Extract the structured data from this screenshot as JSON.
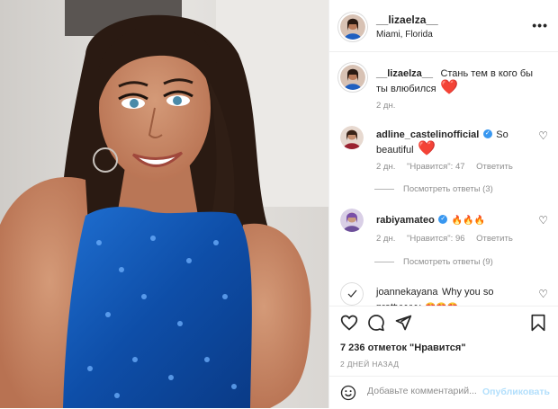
{
  "post": {
    "author": "__lizaelza__",
    "location": "Miami, Florida",
    "more_label": "•••",
    "caption": {
      "user": "__lizaelza__",
      "text": "Стань тем в кого бы ты влюбился",
      "emoji": "❤️",
      "time": "2 дн."
    }
  },
  "comments": [
    {
      "user": "adline_castelinofficial",
      "verified": true,
      "text": "So beautiful",
      "emoji": "❤️",
      "time": "2 дн.",
      "likes": "\"Нравится\": 47",
      "reply": "Ответить",
      "view_replies": "Посмотреть ответы (3)"
    },
    {
      "user": "rabiyamateo",
      "verified": true,
      "text": "",
      "emoji": "🔥🔥🔥",
      "time": "2 дн.",
      "likes": "\"Нравится\": 96",
      "reply": "Ответить",
      "view_replies": "Посмотреть ответы (9)"
    },
    {
      "user": "joannekayana",
      "verified": false,
      "text": "Why you so prettyyyyy",
      "emoji": "😍😍😍"
    }
  ],
  "actions": {
    "likes": "7 236 отметок \"Нравится\"",
    "date": "2 ДНЕЙ НАЗАД",
    "comment_placeholder": "Добавьте комментарий...",
    "post_button": "Опубликовать"
  },
  "icons": [
    "heart-icon",
    "comment-icon",
    "share-icon",
    "bookmark-icon",
    "emoji-icon",
    "verified-icon",
    "more-icon"
  ],
  "colors": {
    "accent_blue": "#0095f6",
    "post_disabled": "#b2dffc",
    "heart_red": "#ed4956",
    "muted": "#8e8e8e"
  }
}
